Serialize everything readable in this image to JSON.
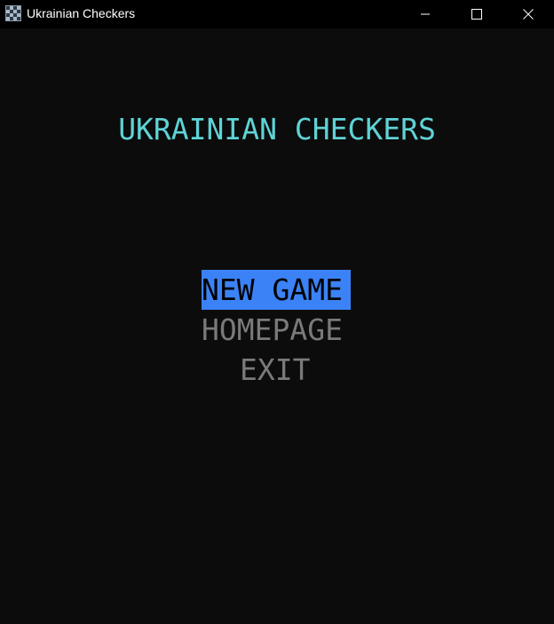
{
  "window": {
    "title": "Ukrainian Checkers",
    "icon": "checkerboard-icon",
    "controls": {
      "minimize_icon": "minimize-icon",
      "maximize_icon": "maximize-icon",
      "close_icon": "close-icon"
    }
  },
  "game": {
    "title": "UKRAINIAN CHECKERS",
    "title_color": "#5fd3d6"
  },
  "menu": {
    "items": [
      {
        "label": "NEW GAME",
        "selected": true
      },
      {
        "label": "HOMEPAGE",
        "selected": false
      },
      {
        "label": "EXIT",
        "selected": false
      }
    ],
    "selected_bg": "#3b82f6",
    "unselected_color": "#7a7a7a"
  },
  "colors": {
    "background": "#0c0c0c",
    "titlebar": "#000000"
  }
}
